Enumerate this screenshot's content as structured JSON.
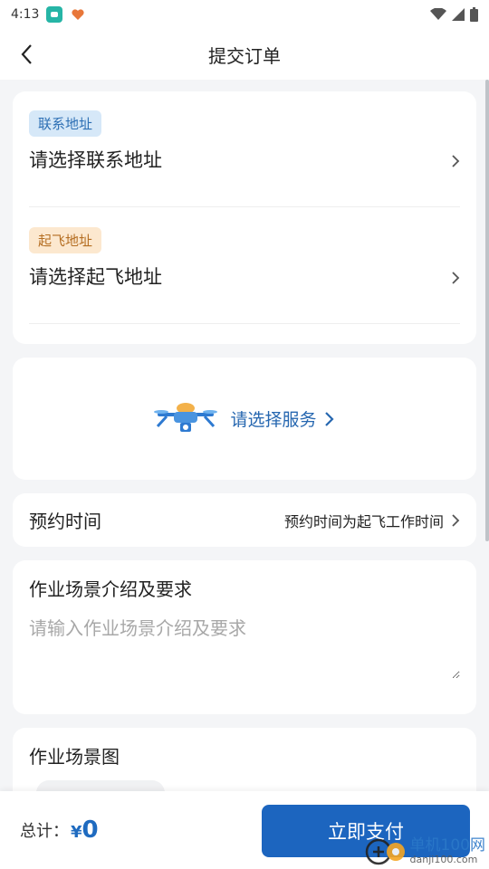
{
  "status_bar": {
    "time": "4:13"
  },
  "nav": {
    "title": "提交订单"
  },
  "address": {
    "contact_tag": "联系地址",
    "contact_placeholder": "请选择联系地址",
    "takeoff_tag": "起飞地址",
    "takeoff_placeholder": "请选择起飞地址"
  },
  "service": {
    "link_label": "请选择服务"
  },
  "appointment": {
    "label": "预约时间",
    "value": "预约时间为起飞工作时间"
  },
  "scene": {
    "title": "作业场景介绍及要求",
    "placeholder": "请输入作业场景介绍及要求"
  },
  "scene_image": {
    "title": "作业场景图"
  },
  "footer": {
    "total_label": "总计：",
    "currency": "¥",
    "total_value": "0",
    "pay_label": "立即支付"
  },
  "watermark": {
    "text": "单机100网",
    "sub": "danji100.com"
  },
  "colors": {
    "accent": "#1c65bf",
    "tag_blue_bg": "#d6e8f8",
    "tag_orange_bg": "#fce8cf",
    "background": "#f4f5f7"
  }
}
